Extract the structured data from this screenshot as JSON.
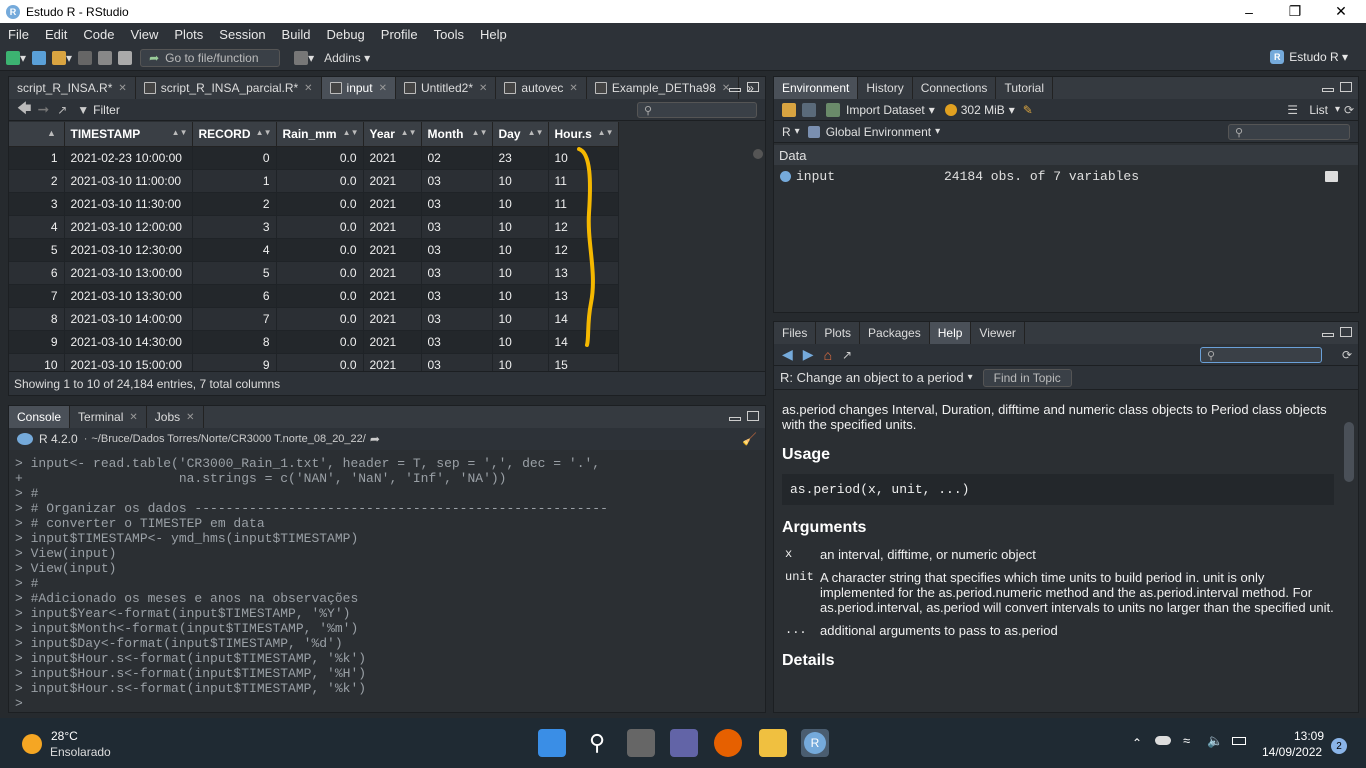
{
  "window": {
    "title": "Estudo R - RStudio",
    "app_letter": "R"
  },
  "menu": [
    "File",
    "Edit",
    "Code",
    "View",
    "Plots",
    "Session",
    "Build",
    "Debug",
    "Profile",
    "Tools",
    "Help"
  ],
  "toolbar": {
    "goto_placeholder": "Go to file/function",
    "addins_label": "Addins",
    "project_label": "Estudo R"
  },
  "source": {
    "tabs": [
      {
        "label": "script_R_INSA.R*",
        "active": false
      },
      {
        "label": "script_R_INSA_parcial.R*",
        "active": false
      },
      {
        "label": "input",
        "active": true
      },
      {
        "label": "Untitled2*",
        "active": false
      },
      {
        "label": "autovec",
        "active": false
      },
      {
        "label": "Example_DETha98",
        "active": false
      }
    ],
    "filter_label": "Filter",
    "columns": [
      "",
      "TIMESTAMP",
      "RECORD",
      "Rain_mm",
      "Year",
      "Month",
      "Day",
      "Hour.s"
    ],
    "rows": [
      [
        "1",
        "2021-02-23 10:00:00",
        "0",
        "0.0",
        "2021",
        "02",
        "23",
        "10"
      ],
      [
        "2",
        "2021-03-10 11:00:00",
        "1",
        "0.0",
        "2021",
        "03",
        "10",
        "11"
      ],
      [
        "3",
        "2021-03-10 11:30:00",
        "2",
        "0.0",
        "2021",
        "03",
        "10",
        "11"
      ],
      [
        "4",
        "2021-03-10 12:00:00",
        "3",
        "0.0",
        "2021",
        "03",
        "10",
        "12"
      ],
      [
        "5",
        "2021-03-10 12:30:00",
        "4",
        "0.0",
        "2021",
        "03",
        "10",
        "12"
      ],
      [
        "6",
        "2021-03-10 13:00:00",
        "5",
        "0.0",
        "2021",
        "03",
        "10",
        "13"
      ],
      [
        "7",
        "2021-03-10 13:30:00",
        "6",
        "0.0",
        "2021",
        "03",
        "10",
        "13"
      ],
      [
        "8",
        "2021-03-10 14:00:00",
        "7",
        "0.0",
        "2021",
        "03",
        "10",
        "14"
      ],
      [
        "9",
        "2021-03-10 14:30:00",
        "8",
        "0.0",
        "2021",
        "03",
        "10",
        "14"
      ],
      [
        "10",
        "2021-03-10 15:00:00",
        "9",
        "0.0",
        "2021",
        "03",
        "10",
        "15"
      ]
    ],
    "status": "Showing 1 to 10 of 24,184 entries, 7 total columns"
  },
  "console": {
    "tabs": [
      {
        "label": "Console",
        "active": true
      },
      {
        "label": "Terminal"
      },
      {
        "label": "Jobs"
      }
    ],
    "r_version": "R 4.2.0",
    "path": "~/Bruce/Dados Torres/Norte/CR3000 T.norte_08_20_22/",
    "lines": [
      "> input<- read.table('CR3000_Rain_1.txt', header = T, sep = ',', dec = '.',",
      "+                    na.strings = c('NAN', 'NaN', 'Inf', 'NA'))",
      "> #",
      "> # Organizar os dados -----------------------------------------------------",
      "> # converter o TIMESTEP em data",
      "> input$TIMESTAMP<- ymd_hms(input$TIMESTAMP)",
      "> View(input)",
      "> View(input)",
      "> #",
      "> #Adicionado os meses e anos na observações",
      "> input$Year<-format(input$TIMESTAMP, '%Y')",
      "> input$Month<-format(input$TIMESTAMP, '%m')",
      "> input$Day<-format(input$TIMESTAMP, '%d')",
      "> input$Hour.s<-format(input$TIMESTAMP, '%k')",
      "> input$Hour.s<-format(input$TIMESTAMP, '%H')",
      "> input$Hour.s<-format(input$TIMESTAMP, '%k')",
      "> "
    ]
  },
  "env": {
    "tabs": [
      {
        "label": "Environment",
        "active": true
      },
      {
        "label": "History"
      },
      {
        "label": "Connections"
      },
      {
        "label": "Tutorial"
      }
    ],
    "import_label": "Import Dataset",
    "memory": "302 MiB",
    "list_label": "List",
    "lang": "R",
    "scope": "Global Environment",
    "section": "Data",
    "var_name": "input",
    "var_desc": "24184 obs. of 7 variables"
  },
  "help": {
    "tabs": [
      {
        "label": "Files"
      },
      {
        "label": "Plots"
      },
      {
        "label": "Packages"
      },
      {
        "label": "Help",
        "active": true
      },
      {
        "label": "Viewer"
      }
    ],
    "topic": "R: Change an object to a period",
    "find_label": "Find in Topic",
    "intro": "as.period changes Interval, Duration, difftime and numeric class objects to Period class objects with the specified units.",
    "usage_heading": "Usage",
    "usage_code": "as.period(x, unit, ...)",
    "arguments_heading": "Arguments",
    "args": [
      {
        "name": "x",
        "desc": "an interval, difftime, or numeric object"
      },
      {
        "name": "unit",
        "desc": "A character string that specifies which time units to build period in. unit is only implemented for the as.period.numeric method and the as.period.interval method. For as.period.interval, as.period will convert intervals to units no larger than the specified unit."
      },
      {
        "name": "...",
        "desc": "additional arguments to pass to as.period"
      }
    ],
    "details_heading": "Details"
  },
  "taskbar": {
    "temp": "28°C",
    "weather": "Ensolarado",
    "time": "13:09",
    "date": "14/09/2022",
    "notifications": "2",
    "r_letter": "R"
  },
  "colors": {
    "annotation": "#f5b800",
    "accent": "#75aadb"
  }
}
